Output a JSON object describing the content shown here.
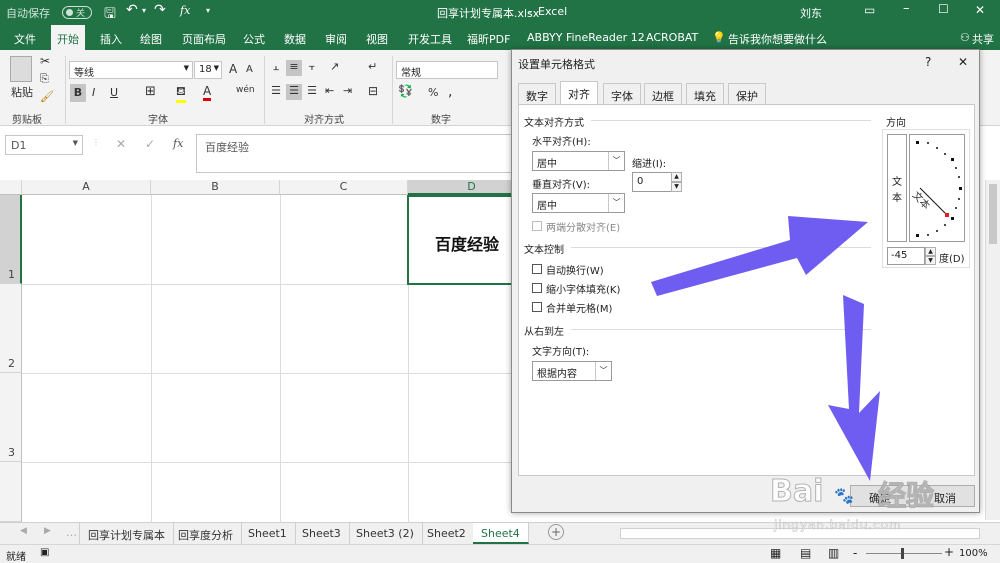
{
  "titlebar": {
    "autosave_label": "自动保存",
    "autosave_state": "关",
    "file_title": "回享计划专属本.xlsx",
    "app_sep": "-",
    "app_name": "Excel",
    "user": "刘东",
    "fx": "fx"
  },
  "ribbon_tabs": [
    "文件",
    "开始",
    "插入",
    "绘图",
    "页面布局",
    "公式",
    "数据",
    "审阅",
    "视图",
    "开发工具",
    "福昕PDF",
    "ABBYY FineReader 12",
    "ACROBAT"
  ],
  "tell_me": "告诉我你想要做什么",
  "share": "共享",
  "ribbon": {
    "paste_label": "粘贴",
    "clipboard_label": "剪贴板",
    "font_name": "等线",
    "font_size": "18",
    "font_label": "字体",
    "grow_font": "A",
    "shrink_font": "A",
    "bold": "B",
    "italic": "I",
    "underline": "U",
    "font_color_glyph": "A",
    "phonetic": "wén",
    "align_label": "对齐方式",
    "number_format": "常规",
    "number_label": "数字",
    "percent": "%",
    "comma": ","
  },
  "formula_bar": {
    "name_box": "D1",
    "cancel": "✕",
    "enter": "✓",
    "fx": "fx",
    "content": "百度经验"
  },
  "grid": {
    "columns": [
      "A",
      "B",
      "C",
      "D"
    ],
    "rows": [
      "1",
      "2",
      "3"
    ],
    "cell_d1": "百度经验"
  },
  "sheet_tabs": [
    "回享计划专属本",
    "回享度分析",
    "Sheet1",
    "Sheet3",
    "Sheet3 (2)",
    "Sheet2",
    "Sheet4"
  ],
  "active_sheet": "Sheet4",
  "add_sheet": "+",
  "statusbar": {
    "ready": "就绪",
    "zoom": "100%",
    "zoom_minus": "-",
    "zoom_plus": "+"
  },
  "dialog": {
    "title": "设置单元格格式",
    "help": "?",
    "close": "✕",
    "tabs": [
      "数字",
      "对齐",
      "字体",
      "边框",
      "填充",
      "保护"
    ],
    "active_tab": "对齐",
    "text_align_section": "文本对齐方式",
    "horizontal_label": "水平对齐(H):",
    "horizontal_value": "居中",
    "indent_label": "缩进(I):",
    "indent_value": "0",
    "vertical_label": "垂直对齐(V):",
    "vertical_value": "居中",
    "distributed_label": "两端分散对齐(E)",
    "text_control_section": "文本控制",
    "wrap_label": "自动换行(W)",
    "shrink_label": "缩小字体填充(K)",
    "merge_label": "合并单元格(M)",
    "rtl_section": "从右到左",
    "text_direction_label": "文字方向(T):",
    "text_direction_value": "根据内容",
    "orientation_section": "方向",
    "vertical_text": [
      "文",
      "本"
    ],
    "dial_text": "文本",
    "degrees_value": "-45",
    "degrees_label": "度(D)",
    "ok": "确定",
    "cancel": "取消"
  },
  "watermark": {
    "brand": "Bai",
    "brand_tail": "经验",
    "url": "jingyan.baidu.com"
  },
  "colors": {
    "excel_green": "#217346",
    "arrow": "#6f5cf0",
    "selection": "#217346"
  }
}
